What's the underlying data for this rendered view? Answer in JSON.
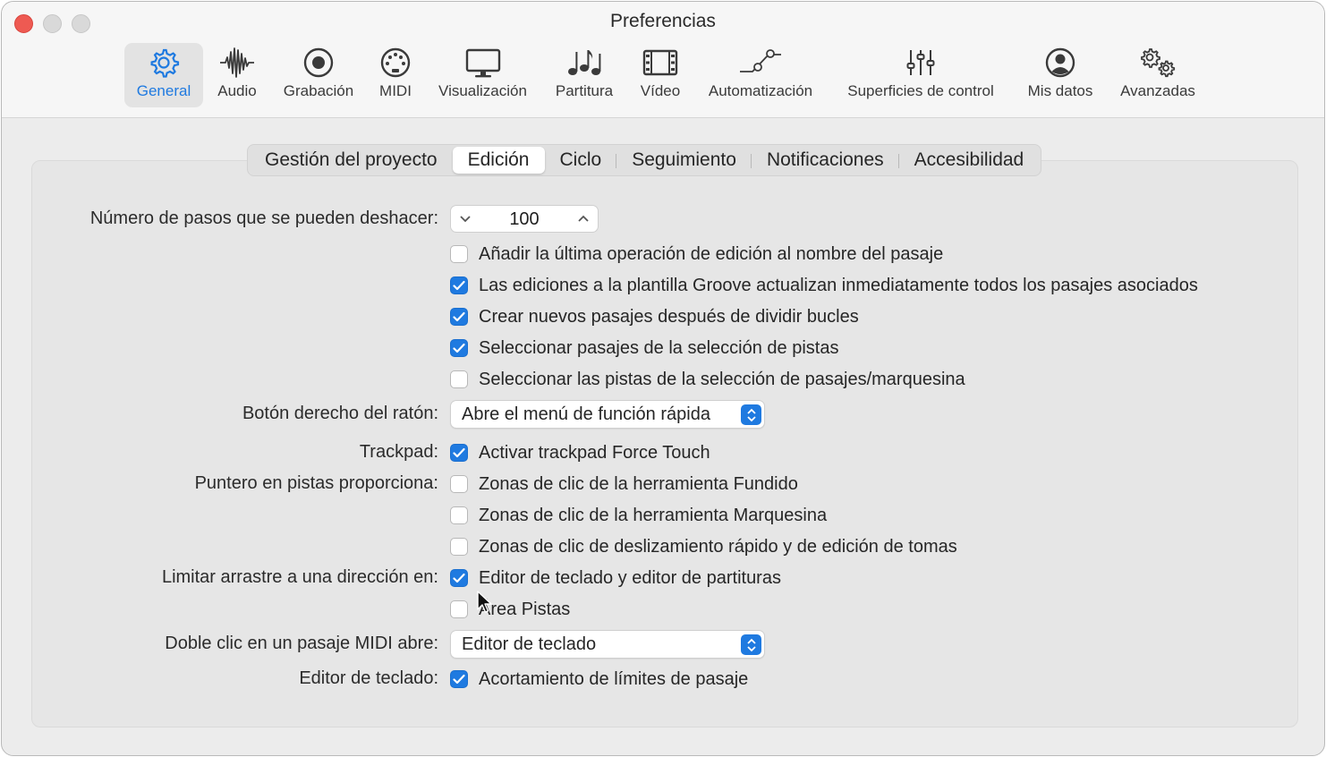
{
  "window": {
    "title": "Preferencias"
  },
  "toolbar": {
    "items": [
      {
        "label": "General",
        "icon": "gear-icon",
        "active": true
      },
      {
        "label": "Audio",
        "icon": "waveform-icon"
      },
      {
        "label": "Grabación",
        "icon": "record-icon"
      },
      {
        "label": "MIDI",
        "icon": "midi-port-icon"
      },
      {
        "label": "Visualización",
        "icon": "display-icon"
      },
      {
        "label": "Partitura",
        "icon": "music-notes-icon"
      },
      {
        "label": "Vídeo",
        "icon": "film-icon"
      },
      {
        "label": "Automatización",
        "icon": "automation-curve-icon"
      },
      {
        "label": "Superficies de control",
        "icon": "sliders-icon"
      },
      {
        "label": "Mis datos",
        "icon": "person-icon"
      },
      {
        "label": "Avanzadas",
        "icon": "gears-icon"
      }
    ]
  },
  "tabs": [
    {
      "label": "Gestión del proyecto"
    },
    {
      "label": "Edición",
      "active": true
    },
    {
      "label": "Ciclo"
    },
    {
      "label": "Seguimiento"
    },
    {
      "label": "Notificaciones"
    },
    {
      "label": "Accesibilidad"
    }
  ],
  "accent_color": "#1f7ae0",
  "settings": {
    "undo_label": "Número de pasos que se pueden deshacer:",
    "undo_value": "100",
    "checks": [
      {
        "text": "Añadir la última operación de edición al nombre del pasaje",
        "checked": false
      },
      {
        "text": "Las ediciones a la plantilla Groove actualizan inmediatamente todos los pasajes asociados",
        "checked": true
      },
      {
        "text": "Crear nuevos pasajes después de dividir bucles",
        "checked": true
      },
      {
        "text": "Seleccionar pasajes de la selección de pistas",
        "checked": true
      },
      {
        "text": "Seleccionar las pistas de la selección de pasajes/marquesina",
        "checked": false
      }
    ],
    "right_click_label": "Botón derecho del ratón:",
    "right_click_value": "Abre el menú de función rápida",
    "trackpad_label": "Trackpad:",
    "trackpad": {
      "text": "Activar trackpad Force Touch",
      "checked": true
    },
    "pointer_label": "Puntero en pistas proporciona:",
    "pointer": [
      {
        "text": "Zonas de clic de la herramienta Fundido",
        "checked": false
      },
      {
        "text": "Zonas de clic de la herramienta Marquesina",
        "checked": false
      },
      {
        "text": "Zonas de clic de deslizamiento rápido y de edición de tomas",
        "checked": false
      }
    ],
    "limit_label": "Limitar arrastre a una dirección en:",
    "limit": [
      {
        "text": "Editor de teclado y editor de partituras",
        "checked": true
      },
      {
        "text": "Área Pistas",
        "checked": false
      }
    ],
    "doubleclick_label": "Doble clic en un pasaje MIDI abre:",
    "doubleclick_value": "Editor de teclado",
    "piano_label": "Editor de teclado:",
    "piano": {
      "text": "Acortamiento de límites de pasaje",
      "checked": true
    }
  }
}
